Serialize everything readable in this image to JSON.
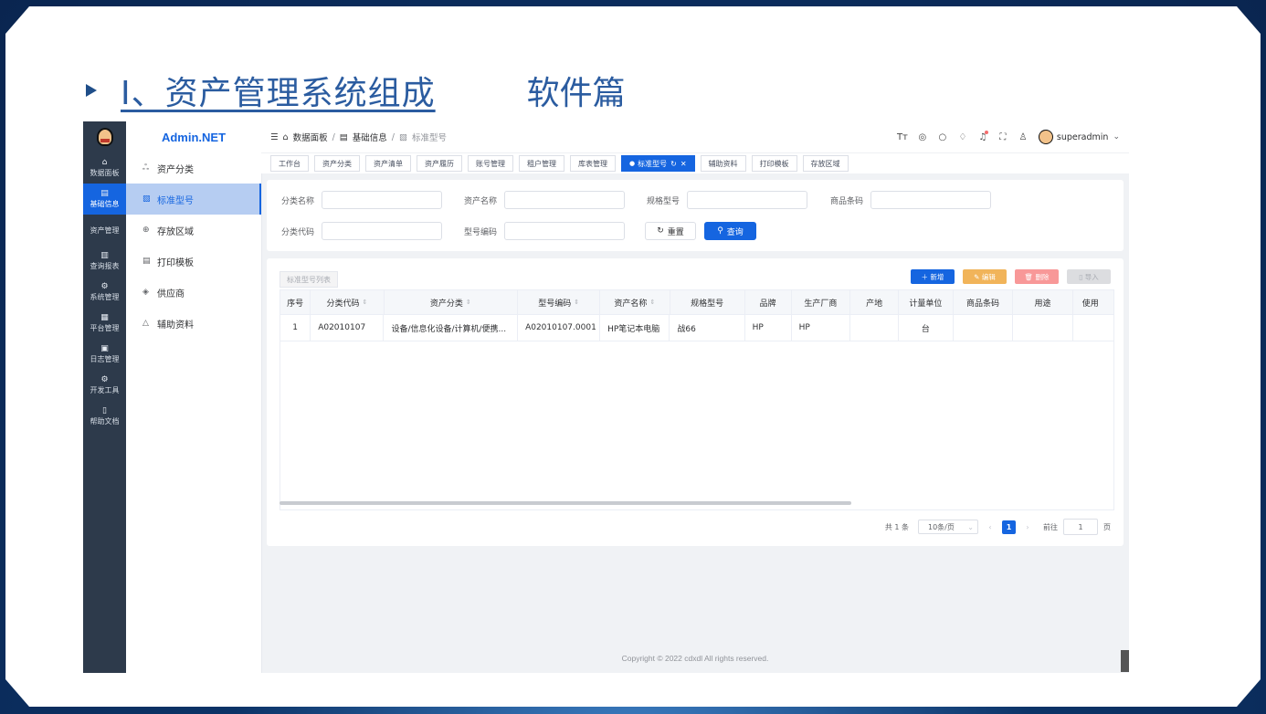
{
  "slide": {
    "title": "Ⅰ、资产管理系统组成",
    "subtitle": "软件篇"
  },
  "nav": {
    "items": [
      {
        "icon": "⌂",
        "label": "数据面板"
      },
      {
        "icon": "▤",
        "label": "基础信息"
      },
      {
        "icon": "",
        "label": "资产管理"
      },
      {
        "icon": "▥",
        "label": "查询报表"
      },
      {
        "icon": "⚙",
        "label": "系统管理"
      },
      {
        "icon": "▦",
        "label": "平台管理"
      },
      {
        "icon": "▣",
        "label": "日志管理"
      },
      {
        "icon": "⚙",
        "label": "开发工具"
      },
      {
        "icon": "▯",
        "label": "帮助文档"
      }
    ]
  },
  "sidebar": {
    "brand": "Admin.NET",
    "items": [
      {
        "icon": "ஃ",
        "label": "资产分类"
      },
      {
        "icon": "▧",
        "label": "标准型号"
      },
      {
        "icon": "⊕",
        "label": "存放区域"
      },
      {
        "icon": "▤",
        "label": "打印模板"
      },
      {
        "icon": "◈",
        "label": "供应商"
      },
      {
        "icon": "△",
        "label": "辅助资料"
      }
    ]
  },
  "breadcrumb": {
    "home": "数据面板",
    "parent": "基础信息",
    "current": "标准型号",
    "sep": "/"
  },
  "header": {
    "user": "superadmin",
    "icons": [
      "Tт",
      "◎",
      "○",
      "♢",
      "♫",
      "⛶",
      "♙"
    ]
  },
  "tabs": [
    "工作台",
    "资产分类",
    "资产清单",
    "资产履历",
    "账号管理",
    "租户管理",
    "库表管理",
    "标准型号",
    "辅助资料",
    "打印模板",
    "存放区域"
  ],
  "active_tab": "标准型号",
  "search": {
    "labels": {
      "category_name": "分类名称",
      "asset_name": "资产名称",
      "spec": "规格型号",
      "barcode": "商品条码",
      "category_code": "分类代码",
      "model_code": "型号编码"
    },
    "reset": "重置",
    "query": "查询"
  },
  "table": {
    "list_tab": "标准型号列表",
    "actions": {
      "add": "新增",
      "edit": "编辑",
      "delete": "删除",
      "import": "导入"
    },
    "columns": [
      "序号",
      "分类代码",
      "资产分类",
      "型号编码",
      "资产名称",
      "规格型号",
      "品牌",
      "生产厂商",
      "产地",
      "计量单位",
      "商品条码",
      "用途",
      "使用"
    ],
    "rows": [
      [
        "1",
        "A02010107",
        "设备/信息化设备/计算机/便携...",
        "A02010107.0001",
        "HP笔记本电脑",
        "战66",
        "HP",
        "HP",
        "",
        "台",
        "",
        "",
        ""
      ]
    ]
  },
  "pager": {
    "total": "共 1 条",
    "size": "10条/页",
    "page": "1",
    "goto_prefix": "前往",
    "goto_value": "1",
    "goto_suffix": "页"
  },
  "footer": "Copyright © 2022 cdxdl All rights reserved.",
  "colors": {
    "primary": "#1565e0",
    "nav_bg": "#2d3a4b",
    "title": "#2b5ca0",
    "edit": "#f1b45a",
    "delete": "#f89898"
  }
}
